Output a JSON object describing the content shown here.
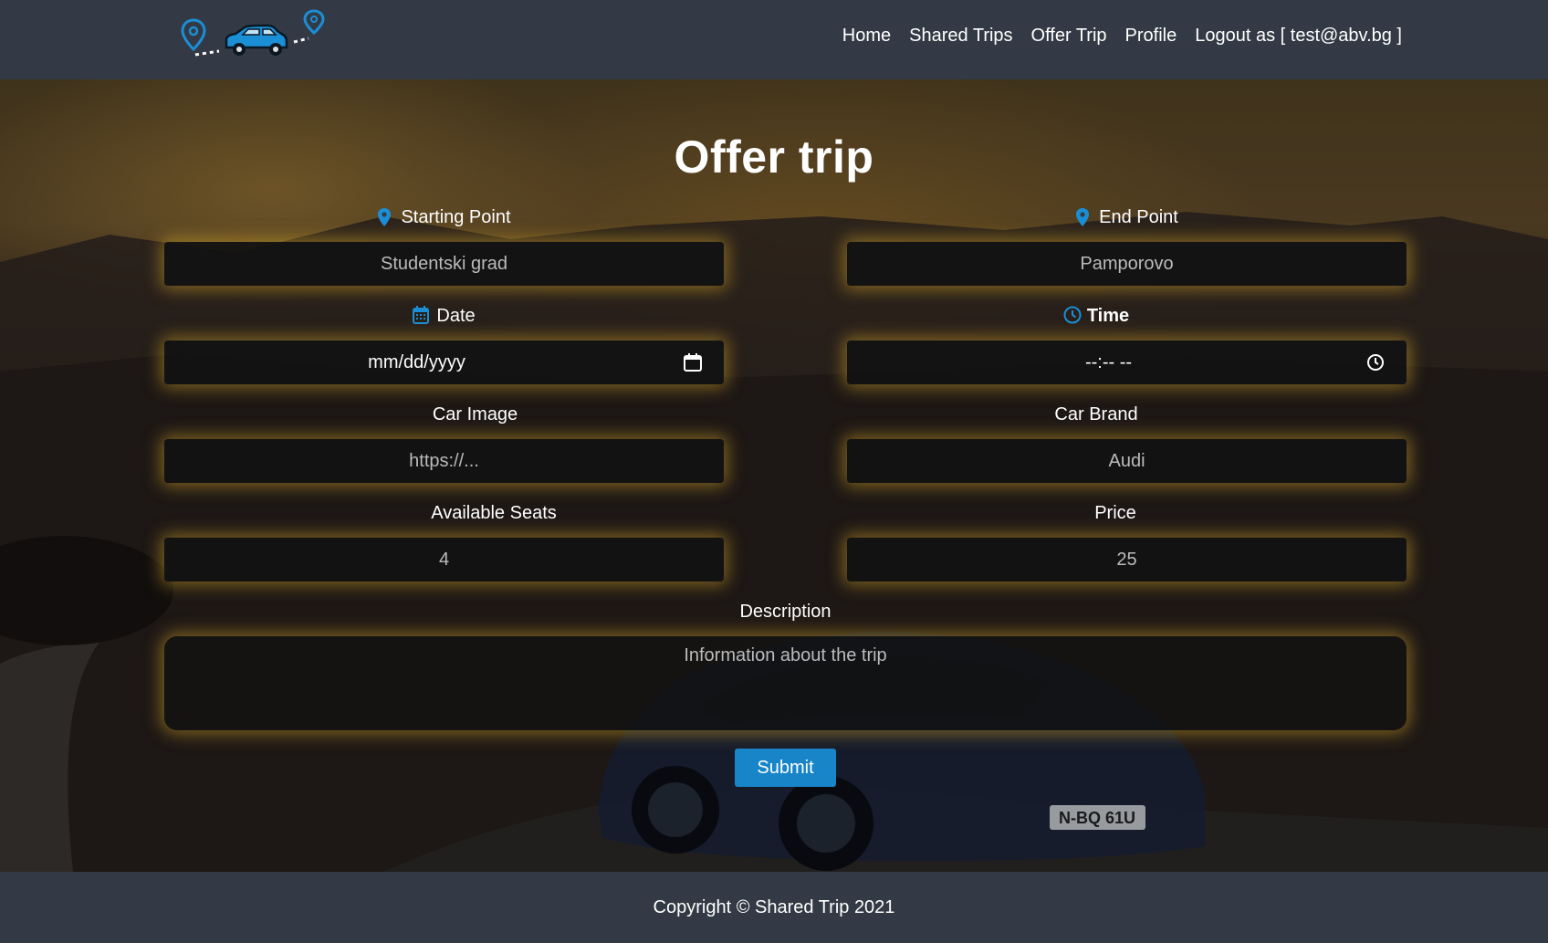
{
  "nav": {
    "items": [
      "Home",
      "Shared Trips",
      "Offer Trip",
      "Profile"
    ],
    "logout": "Logout as [ test@abv.bg ]"
  },
  "page": {
    "title": "Offer trip"
  },
  "form": {
    "starting_point": {
      "label": "Starting Point",
      "placeholder": "Studentski grad"
    },
    "end_point": {
      "label": "End Point",
      "placeholder": "Pamporovo"
    },
    "date": {
      "label": "Date",
      "value": "mm/dd/yyyy"
    },
    "time": {
      "label": "Time",
      "value": "--:-- --"
    },
    "car_image": {
      "label": "Car Image",
      "placeholder": "https://..."
    },
    "car_brand": {
      "label": "Car Brand",
      "placeholder": "Audi"
    },
    "seats": {
      "label": "Available Seats",
      "placeholder": "4"
    },
    "price": {
      "label": "Price",
      "placeholder": "25"
    },
    "description": {
      "label": "Description",
      "placeholder": "Information about the trip"
    },
    "submit_label": "Submit"
  },
  "background": {
    "license_plate": "N-BQ 61U"
  },
  "footer": {
    "text": "Copyright © Shared Trip 2021"
  },
  "colors": {
    "accent": "#1785c8",
    "glow": "#cda028",
    "header_bg": "#343a45",
    "field_bg": "#121212"
  }
}
